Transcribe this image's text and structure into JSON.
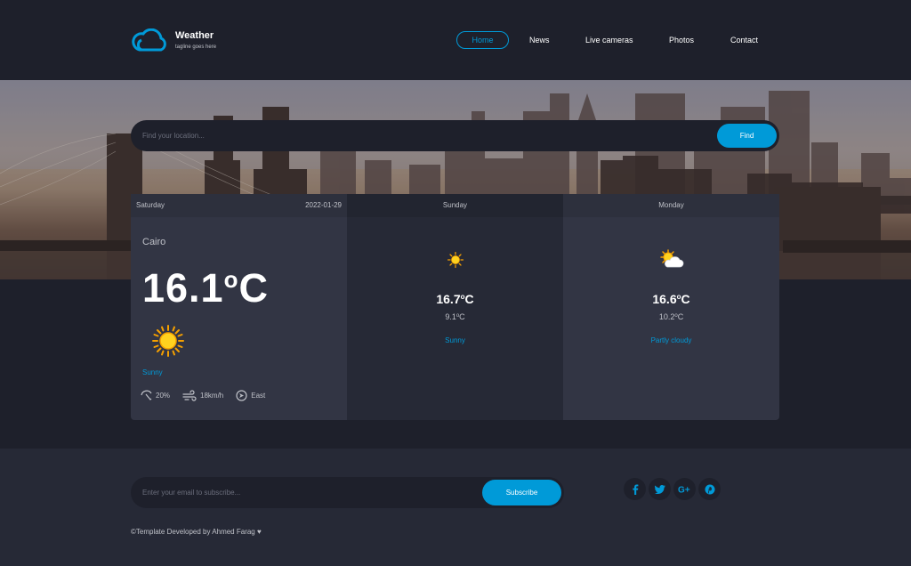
{
  "header": {
    "brand": "Weather",
    "tagline": "tagline goes here",
    "nav": [
      {
        "label": "Home",
        "active": true
      },
      {
        "label": "News"
      },
      {
        "label": "Live cameras"
      },
      {
        "label": "Photos"
      },
      {
        "label": "Contact"
      }
    ]
  },
  "search": {
    "placeholder": "Find your location...",
    "button": "Find"
  },
  "forecast": {
    "today": {
      "day": "Saturday",
      "date": "2022-01-29",
      "city": "Cairo",
      "temp": "16.1",
      "unit": "C",
      "condition": "Sunny",
      "rain": "20%",
      "wind": "18km/h",
      "direction": "East",
      "icon": "sun-icon"
    },
    "next": [
      {
        "day": "Sunday",
        "max": "16.7",
        "min": "9.1",
        "unit": "C",
        "condition": "Sunny",
        "icon": "sun-icon"
      },
      {
        "day": "Monday",
        "max": "16.6",
        "min": "10.2",
        "unit": "C",
        "condition": "Partly cloudy",
        "icon": "partly-cloudy-icon"
      }
    ]
  },
  "footer": {
    "email_placeholder": "Enter your email to subscribe...",
    "subscribe": "Subscribe",
    "social": [
      "facebook-icon",
      "twitter-icon",
      "google-plus-icon",
      "pinterest-icon"
    ],
    "copyright": "©Template Developed by Ahmed Farag ♥"
  },
  "colors": {
    "accent": "#009ad8",
    "background": "#1e202b",
    "card": "#323544",
    "card_alt": "#262936"
  }
}
